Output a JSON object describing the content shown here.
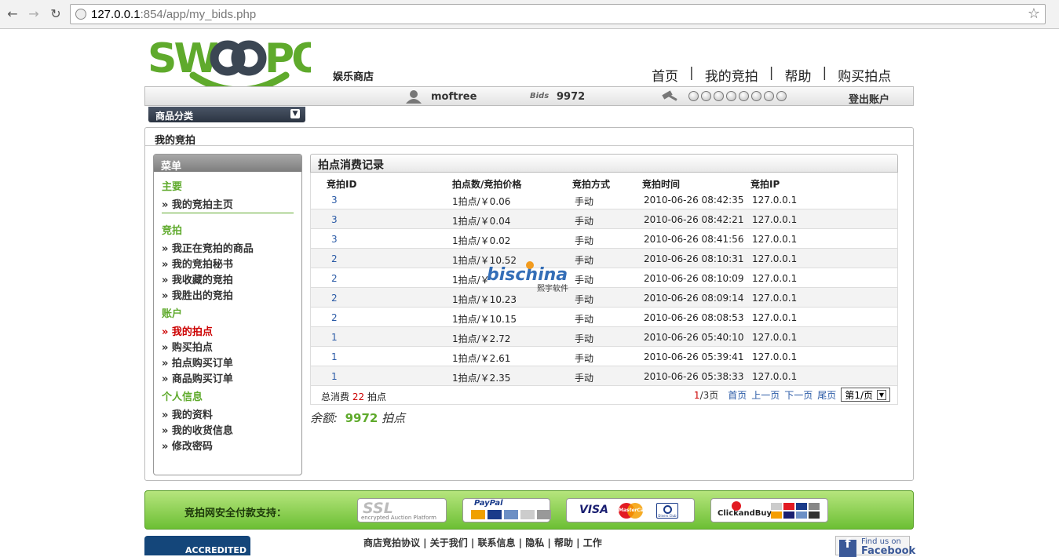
{
  "browser": {
    "url_host": "127.0.0.1",
    "url_rest": ":854/app/my_bids.php"
  },
  "header": {
    "logo_text": "SWOOPO",
    "shop_label": "娱乐商店",
    "nav": [
      "首页",
      "我的竞拍",
      "帮助",
      "购买拍点"
    ],
    "nav_separator": "|",
    "username": "moftree",
    "bids_label": "Bids",
    "bids_count": "9972",
    "logout": "登出账户",
    "category_button": "商品分类"
  },
  "page": {
    "title": "我的竞拍"
  },
  "sidebar": {
    "title": "菜单",
    "sections": [
      {
        "title": "主要",
        "items": [
          {
            "label": "» 我的竞拍主页",
            "active": false
          }
        ],
        "divider": true
      },
      {
        "title": "竞拍",
        "items": [
          {
            "label": "» 我正在竞拍的商品",
            "active": false
          },
          {
            "label": "» 我的竞拍秘书",
            "active": false
          },
          {
            "label": "» 我收藏的竞拍",
            "active": false
          },
          {
            "label": "» 我胜出的竞拍",
            "active": false
          }
        ]
      },
      {
        "title": "账户",
        "items": [
          {
            "label": "» 我的拍点",
            "active": true
          },
          {
            "label": "» 购买拍点",
            "active": false
          },
          {
            "label": "» 拍点购买订单",
            "active": false
          },
          {
            "label": "» 商品购买订单",
            "active": false
          }
        ]
      },
      {
        "title": "个人信息",
        "items": [
          {
            "label": "» 我的资料",
            "active": false
          },
          {
            "label": "» 我的收货信息",
            "active": false
          },
          {
            "label": "» 修改密码",
            "active": false
          }
        ]
      }
    ]
  },
  "records": {
    "title": "拍点消费记录",
    "columns": [
      "竞拍ID",
      "拍点数/竞拍价格",
      "竞拍方式",
      "竞拍时间",
      "竞拍IP"
    ],
    "rows": [
      {
        "id": "3",
        "price": "1拍点/￥0.06",
        "mode": "手动",
        "time": "2010-06-26 08:42:35",
        "ip": "127.0.0.1"
      },
      {
        "id": "3",
        "price": "1拍点/￥0.04",
        "mode": "手动",
        "time": "2010-06-26 08:42:21",
        "ip": "127.0.0.1"
      },
      {
        "id": "3",
        "price": "1拍点/￥0.02",
        "mode": "手动",
        "time": "2010-06-26 08:41:56",
        "ip": "127.0.0.1"
      },
      {
        "id": "2",
        "price": "1拍点/￥10.52",
        "mode": "手动",
        "time": "2010-06-26 08:10:31",
        "ip": "127.0.0.1"
      },
      {
        "id": "2",
        "price": "1拍点/￥",
        "mode": "手动",
        "time": "2010-06-26 08:10:09",
        "ip": "127.0.0.1"
      },
      {
        "id": "2",
        "price": "1拍点/￥10.23",
        "mode": "手动",
        "time": "2010-06-26 08:09:14",
        "ip": "127.0.0.1"
      },
      {
        "id": "2",
        "price": "1拍点/￥10.15",
        "mode": "手动",
        "time": "2010-06-26 08:08:53",
        "ip": "127.0.0.1"
      },
      {
        "id": "1",
        "price": "1拍点/￥2.72",
        "mode": "手动",
        "time": "2010-06-26 05:40:10",
        "ip": "127.0.0.1"
      },
      {
        "id": "1",
        "price": "1拍点/￥2.61",
        "mode": "手动",
        "time": "2010-06-26 05:39:41",
        "ip": "127.0.0.1"
      },
      {
        "id": "1",
        "price": "1拍点/￥2.35",
        "mode": "手动",
        "time": "2010-06-26 05:38:33",
        "ip": "127.0.0.1"
      }
    ],
    "total_prefix": "总消费",
    "total_value": "22",
    "total_suffix": "拍点",
    "page_current": "1",
    "page_total": "/3页",
    "first": "首页",
    "prev": "上一页",
    "next": "下一页",
    "last": "尾页",
    "page_select": "第1/页",
    "balance_label": "余额:",
    "balance_value": "9972",
    "balance_unit": "拍点"
  },
  "watermark": {
    "main": "bischina",
    "sub": "熙宇软件"
  },
  "footer": {
    "payment_label": "竞拍网安全付款支持：",
    "payment_logos": [
      "SSL encrypted Auction Platform",
      "PayPal",
      "VISA / MasterCard / Diners Club",
      "ClickandBuy"
    ],
    "ssl_main": "SSL",
    "ssl_sub": "encrypted Auction Platform",
    "paypal_label": "PayPal",
    "visa_label": "VISA",
    "mastercard_label": "MasterCard",
    "diners_label": "Diners Club",
    "clickandbuy_label": "ClickandBuy",
    "links": "商店竞拍协议 | 关于我们 | 联系信息 | 隐私 | 帮助 | 工作",
    "bbb_label": "ACCREDITED",
    "facebook_line1": "Find us on",
    "facebook_line2": "Facebook"
  },
  "colors": {
    "brand_green": "#5faa2c",
    "logo_gray": "#3b4653",
    "link_blue": "#2a5aa6",
    "active_red": "#cc0000"
  }
}
